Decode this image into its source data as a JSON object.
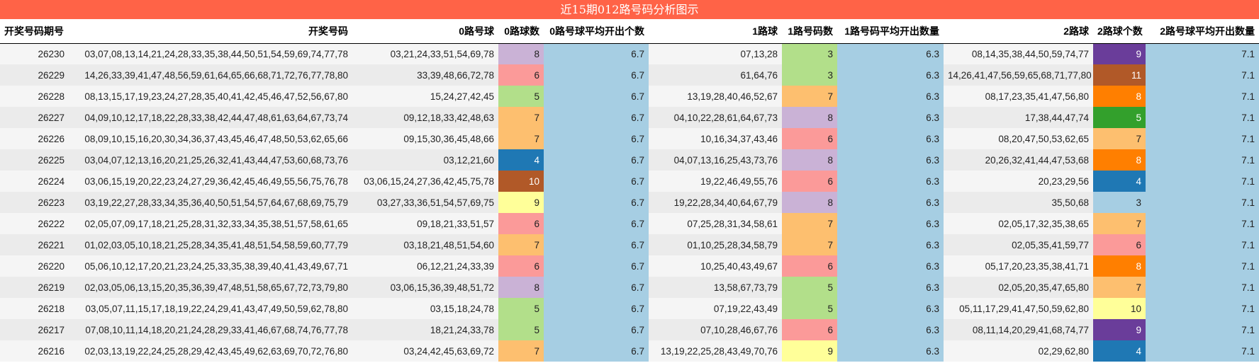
{
  "title": "近15期012路号码分析图示",
  "headers": [
    "开奖号码期号",
    "开奖号码",
    "0路号球",
    "0路球数",
    "0路号球平均开出个数",
    "1路球",
    "1路号码数",
    "1路号码平均开出数量",
    "2路球",
    "2路球个数",
    "2路号球平均开出数量"
  ],
  "colors": {
    "1": "#a6cee3",
    "2": "#1f78b4",
    "3": "#b2df8a",
    "4": "#1f78b4",
    "5": "#b2df8a",
    "6": "#fb9a99",
    "7": "#fdbf6f",
    "8": "#cab2d6",
    "9": "#ffff99",
    "10": "#b15928",
    "11": "#b15928"
  },
  "rows": [
    {
      "period": "26230",
      "numbers": "03,07,08,13,14,21,24,28,33,35,38,44,50,51,54,59,69,74,77,78",
      "r0_balls": "03,21,24,33,51,54,69,78",
      "r0_count": "8",
      "r0_avg": "6.7",
      "r1_balls": "07,13,28",
      "r1_count": "3",
      "r1_avg": "6.3",
      "r2_balls": "08,14,35,38,44,50,59,74,77",
      "r2_count": "9",
      "r2_avg": "7.1"
    },
    {
      "period": "26229",
      "numbers": "14,26,33,39,41,47,48,56,59,61,64,65,66,68,71,72,76,77,78,80",
      "r0_balls": "33,39,48,66,72,78",
      "r0_count": "6",
      "r0_avg": "6.7",
      "r1_balls": "61,64,76",
      "r1_count": "3",
      "r1_avg": "6.3",
      "r2_balls": "14,26,41,47,56,59,65,68,71,77,80",
      "r2_count": "11",
      "r2_avg": "7.1"
    },
    {
      "period": "26228",
      "numbers": "08,13,15,17,19,23,24,27,28,35,40,41,42,45,46,47,52,56,67,80",
      "r0_balls": "15,24,27,42,45",
      "r0_count": "5",
      "r0_avg": "6.7",
      "r1_balls": "13,19,28,40,46,52,67",
      "r1_count": "7",
      "r1_avg": "6.3",
      "r2_balls": "08,17,23,35,41,47,56,80",
      "r2_count": "8",
      "r2_avg": "7.1"
    },
    {
      "period": "26227",
      "numbers": "04,09,10,12,17,18,22,28,33,38,42,44,47,48,61,63,64,67,73,74",
      "r0_balls": "09,12,18,33,42,48,63",
      "r0_count": "7",
      "r0_avg": "6.7",
      "r1_balls": "04,10,22,28,61,64,67,73",
      "r1_count": "8",
      "r1_avg": "6.3",
      "r2_balls": "17,38,44,47,74",
      "r2_count": "5",
      "r2_avg": "7.1"
    },
    {
      "period": "26226",
      "numbers": "08,09,10,15,16,20,30,34,36,37,43,45,46,47,48,50,53,62,65,66",
      "r0_balls": "09,15,30,36,45,48,66",
      "r0_count": "7",
      "r0_avg": "6.7",
      "r1_balls": "10,16,34,37,43,46",
      "r1_count": "6",
      "r1_avg": "6.3",
      "r2_balls": "08,20,47,50,53,62,65",
      "r2_count": "7",
      "r2_avg": "7.1"
    },
    {
      "period": "26225",
      "numbers": "03,04,07,12,13,16,20,21,25,26,32,41,43,44,47,53,60,68,73,76",
      "r0_balls": "03,12,21,60",
      "r0_count": "4",
      "r0_avg": "6.7",
      "r1_balls": "04,07,13,16,25,43,73,76",
      "r1_count": "8",
      "r1_avg": "6.3",
      "r2_balls": "20,26,32,41,44,47,53,68",
      "r2_count": "8",
      "r2_avg": "7.1"
    },
    {
      "period": "26224",
      "numbers": "03,06,15,19,20,22,23,24,27,29,36,42,45,46,49,55,56,75,76,78",
      "r0_balls": "03,06,15,24,27,36,42,45,75,78",
      "r0_count": "10",
      "r0_avg": "6.7",
      "r1_balls": "19,22,46,49,55,76",
      "r1_count": "6",
      "r1_avg": "6.3",
      "r2_balls": "20,23,29,56",
      "r2_count": "4",
      "r2_avg": "7.1"
    },
    {
      "period": "26223",
      "numbers": "03,19,22,27,28,33,34,35,36,40,50,51,54,57,64,67,68,69,75,79",
      "r0_balls": "03,27,33,36,51,54,57,69,75",
      "r0_count": "9",
      "r0_avg": "6.7",
      "r1_balls": "19,22,28,34,40,64,67,79",
      "r1_count": "8",
      "r1_avg": "6.3",
      "r2_balls": "35,50,68",
      "r2_count": "3",
      "r2_avg": "7.1"
    },
    {
      "period": "26222",
      "numbers": "02,05,07,09,17,18,21,25,28,31,32,33,34,35,38,51,57,58,61,65",
      "r0_balls": "09,18,21,33,51,57",
      "r0_count": "6",
      "r0_avg": "6.7",
      "r1_balls": "07,25,28,31,34,58,61",
      "r1_count": "7",
      "r1_avg": "6.3",
      "r2_balls": "02,05,17,32,35,38,65",
      "r2_count": "7",
      "r2_avg": "7.1"
    },
    {
      "period": "26221",
      "numbers": "01,02,03,05,10,18,21,25,28,34,35,41,48,51,54,58,59,60,77,79",
      "r0_balls": "03,18,21,48,51,54,60",
      "r0_count": "7",
      "r0_avg": "6.7",
      "r1_balls": "01,10,25,28,34,58,79",
      "r1_count": "7",
      "r1_avg": "6.3",
      "r2_balls": "02,05,35,41,59,77",
      "r2_count": "6",
      "r2_avg": "7.1"
    },
    {
      "period": "26220",
      "numbers": "05,06,10,12,17,20,21,23,24,25,33,35,38,39,40,41,43,49,67,71",
      "r0_balls": "06,12,21,24,33,39",
      "r0_count": "6",
      "r0_avg": "6.7",
      "r1_balls": "10,25,40,43,49,67",
      "r1_count": "6",
      "r1_avg": "6.3",
      "r2_balls": "05,17,20,23,35,38,41,71",
      "r2_count": "8",
      "r2_avg": "7.1"
    },
    {
      "period": "26219",
      "numbers": "02,03,05,06,13,15,20,35,36,39,47,48,51,58,65,67,72,73,79,80",
      "r0_balls": "03,06,15,36,39,48,51,72",
      "r0_count": "8",
      "r0_avg": "6.7",
      "r1_balls": "13,58,67,73,79",
      "r1_count": "5",
      "r1_avg": "6.3",
      "r2_balls": "02,05,20,35,47,65,80",
      "r2_count": "7",
      "r2_avg": "7.1"
    },
    {
      "period": "26218",
      "numbers": "03,05,07,11,15,17,18,19,22,24,29,41,43,47,49,50,59,62,78,80",
      "r0_balls": "03,15,18,24,78",
      "r0_count": "5",
      "r0_avg": "6.7",
      "r1_balls": "07,19,22,43,49",
      "r1_count": "5",
      "r1_avg": "6.3",
      "r2_balls": "05,11,17,29,41,47,50,59,62,80",
      "r2_count": "10",
      "r2_avg": "7.1"
    },
    {
      "period": "26217",
      "numbers": "07,08,10,11,14,18,20,21,24,28,29,33,41,46,67,68,74,76,77,78",
      "r0_balls": "18,21,24,33,78",
      "r0_count": "5",
      "r0_avg": "6.7",
      "r1_balls": "07,10,28,46,67,76",
      "r1_count": "6",
      "r1_avg": "6.3",
      "r2_balls": "08,11,14,20,29,41,68,74,77",
      "r2_count": "9",
      "r2_avg": "7.1"
    },
    {
      "period": "26216",
      "numbers": "02,03,13,19,22,24,25,28,29,42,43,45,49,62,63,69,70,72,76,80",
      "r0_balls": "03,24,42,45,63,69,72",
      "r0_count": "7",
      "r0_avg": "6.7",
      "r1_balls": "13,19,22,25,28,43,49,70,76",
      "r1_count": "9",
      "r1_avg": "6.3",
      "r2_balls": "02,29,62,80",
      "r2_count": "4",
      "r2_avg": "7.1"
    }
  ]
}
